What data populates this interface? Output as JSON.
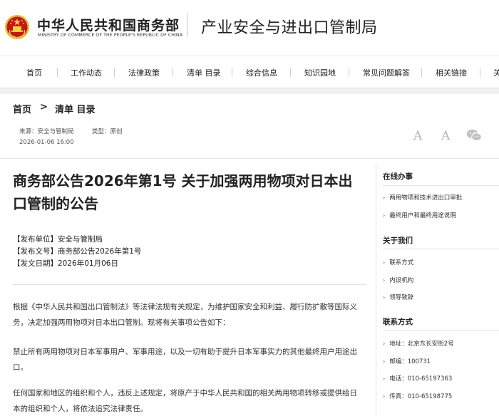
{
  "header": {
    "ministry_cn": "中华人民共和国商务部",
    "ministry_en": "MINISTRY OF COMMERCE OF THE PEOPLE'S REPUBLIC OF CHINA",
    "bureau": "产业安全与进出口管制局",
    "emblem_icon": "national-emblem-icon",
    "colors": {
      "emblem_red": "#c4161c",
      "emblem_gold": "#e8b923"
    }
  },
  "nav": {
    "items": [
      "首页",
      "工作动态",
      "法律政策",
      "清单 目录",
      "综合信息",
      "知识园地",
      "常见问题解答",
      "相关链接",
      "关"
    ]
  },
  "breadcrumb": {
    "home": "首页",
    "separator": ">",
    "current": "清单 目录"
  },
  "meta": {
    "source": "来源：安全与管制局",
    "type": "类型：原创",
    "datetime": "2026-01-06 16:00"
  },
  "tools": {
    "font_large_icon": "font-size-increase-icon",
    "font_small_icon": "font-size-decrease-icon",
    "font_letter": "A",
    "share_icon": "wechat-icon"
  },
  "article": {
    "title": "商务部公告2026年第1号 关于加强两用物项对日本出口管制的公告",
    "info": [
      {
        "label": "【发布单位】",
        "value": "安全与管制局"
      },
      {
        "label": "【发布文号】",
        "value": "商务部公告2026年第1号"
      },
      {
        "label": "【发文日期】",
        "value": "2026年01月06日"
      }
    ],
    "paragraphs": [
      "根据《中华人民共和国出口管制法》等法律法规有关规定，为维护国家安全和利益、履行防扩散等国际义务，决定加强两用物项对日本出口管制。现将有关事项公告如下：",
      "禁止所有两用物项对日本军事用户、军事用途，以及一切有助于提升日本军事实力的其他最终用户用途出口。",
      "任何国家和地区的组织和个人，违反上述规定，将原产于中华人民共和国的相关两用物项转移或提供给日本的组织和个人，将依法追究法律责任。"
    ]
  },
  "sidebar": {
    "sections": [
      {
        "title": "在线办事",
        "items": [
          "两用物项和技术进出口审批",
          "最终用户和最终用途说明"
        ]
      },
      {
        "title": "关于我们",
        "items": [
          "联系方式",
          "内设机构",
          "领导致辞"
        ]
      },
      {
        "title": "联系方式",
        "items": [
          "地址：北京东长安街2号",
          "邮编：100731",
          "电话：010-65197363",
          "传真：010-65198775"
        ]
      }
    ]
  }
}
